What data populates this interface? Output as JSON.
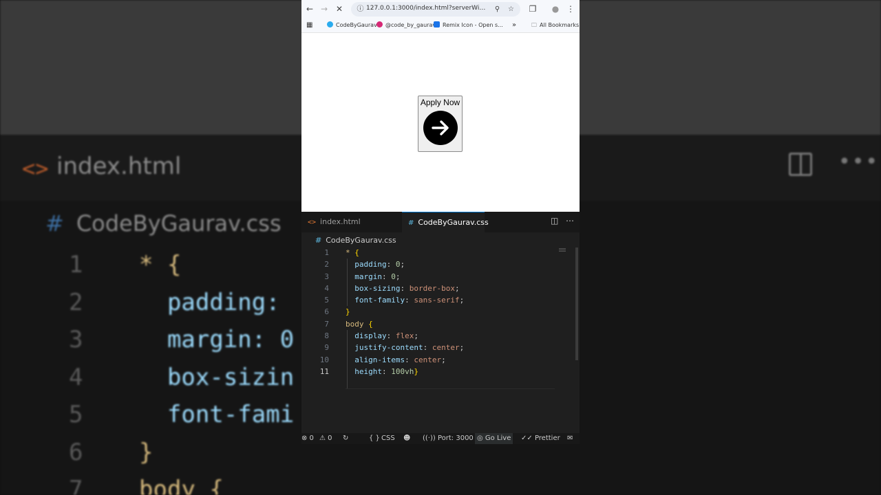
{
  "background": {
    "tab_title": "index.html",
    "crumb": "CodeByGaurav.css",
    "lines": [
      {
        "n": "1",
        "parts": [
          [
            "* ",
            "y"
          ],
          [
            "{",
            "y"
          ]
        ]
      },
      {
        "n": "2",
        "parts": [
          [
            "  padding: ",
            "p"
          ]
        ]
      },
      {
        "n": "3",
        "parts": [
          [
            "  margin: 0",
            "p"
          ]
        ]
      },
      {
        "n": "4",
        "parts": [
          [
            "  box-sizin",
            "p"
          ]
        ]
      },
      {
        "n": "5",
        "parts": [
          [
            "  font-fami",
            "p"
          ]
        ]
      },
      {
        "n": "6",
        "parts": [
          [
            "}",
            "y"
          ]
        ]
      },
      {
        "n": "7",
        "parts": [
          [
            "body ",
            "y"
          ],
          [
            "{",
            "y"
          ]
        ]
      }
    ]
  },
  "browser": {
    "url": "127.0.0.1:3000/index.html?serverWindowId=...",
    "bookmarks": [
      {
        "label": "CodeByGaurav",
        "color": "#2aabee"
      },
      {
        "label": "@code_by_gaurav",
        "color": "#d62976"
      },
      {
        "label": "Remix Icon - Open s...",
        "color": "#1a73e8"
      }
    ],
    "more_bookmarks": "»",
    "all_bookmarks": "All Bookmarks"
  },
  "page": {
    "button_label": "Apply Now"
  },
  "editor": {
    "tabs": [
      {
        "label": "index.html",
        "icon": "<>",
        "active": false
      },
      {
        "label": "CodeByGaurav.css",
        "icon": "#",
        "active": true
      }
    ],
    "breadcrumb": "CodeByGaurav.css",
    "current_line": 11,
    "lines": [
      {
        "n": "1",
        "tokens": [
          [
            "* ",
            "sel"
          ],
          [
            "{",
            "br1"
          ]
        ]
      },
      {
        "n": "2",
        "tokens": [
          [
            "  padding",
            "prop"
          ],
          [
            ": ",
            "w"
          ],
          [
            "0",
            "num"
          ],
          [
            ";",
            "w"
          ]
        ]
      },
      {
        "n": "3",
        "tokens": [
          [
            "  margin",
            "prop"
          ],
          [
            ": ",
            "w"
          ],
          [
            "0",
            "num"
          ],
          [
            ";",
            "w"
          ]
        ]
      },
      {
        "n": "4",
        "tokens": [
          [
            "  box-sizing",
            "prop"
          ],
          [
            ": ",
            "w"
          ],
          [
            "border-box",
            "val"
          ],
          [
            ";",
            "w"
          ]
        ]
      },
      {
        "n": "5",
        "tokens": [
          [
            "  font-family",
            "prop"
          ],
          [
            ": ",
            "w"
          ],
          [
            "sans-serif",
            "val"
          ],
          [
            ";",
            "w"
          ]
        ]
      },
      {
        "n": "6",
        "tokens": [
          [
            "}",
            "br1"
          ]
        ]
      },
      {
        "n": "7",
        "tokens": [
          [
            "body ",
            "sel"
          ],
          [
            "{",
            "br1"
          ]
        ]
      },
      {
        "n": "8",
        "tokens": [
          [
            "  display",
            "prop"
          ],
          [
            ": ",
            "w"
          ],
          [
            "flex",
            "val"
          ],
          [
            ";",
            "w"
          ]
        ]
      },
      {
        "n": "9",
        "tokens": [
          [
            "  justify-content",
            "prop"
          ],
          [
            ": ",
            "w"
          ],
          [
            "center",
            "val"
          ],
          [
            ";",
            "w"
          ]
        ]
      },
      {
        "n": "10",
        "tokens": [
          [
            "  align-items",
            "prop"
          ],
          [
            ": ",
            "w"
          ],
          [
            "center",
            "val"
          ],
          [
            ";",
            "w"
          ]
        ]
      },
      {
        "n": "11",
        "tokens": [
          [
            "  height",
            "prop"
          ],
          [
            ": ",
            "w"
          ],
          [
            "100vh",
            "num"
          ],
          [
            "}",
            "br1"
          ]
        ]
      }
    ]
  },
  "status": {
    "errors": "⊗ 0",
    "warnings": "⚠ 0",
    "language_icon": "{ }",
    "language": "CSS",
    "port": "Port: 3000",
    "go_live": "Go Live",
    "prettier": "Prettier"
  }
}
